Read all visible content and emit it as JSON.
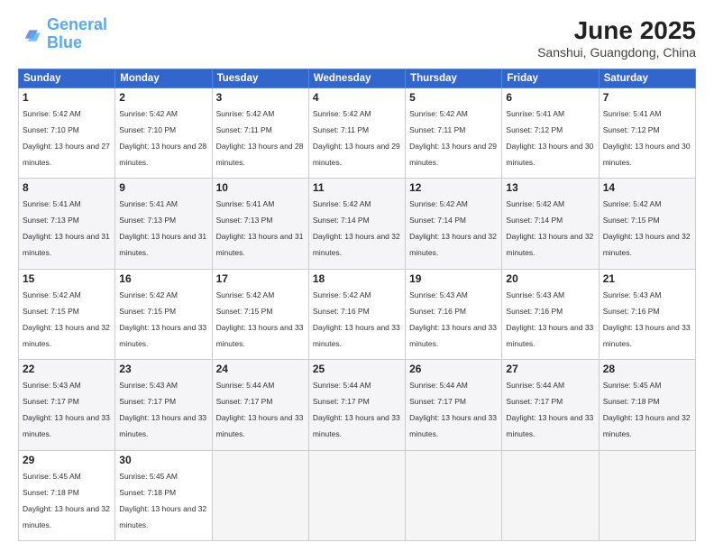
{
  "logo": {
    "line1": "General",
    "line2": "Blue"
  },
  "title": "June 2025",
  "location": "Sanshui, Guangdong, China",
  "weekdays": [
    "Sunday",
    "Monday",
    "Tuesday",
    "Wednesday",
    "Thursday",
    "Friday",
    "Saturday"
  ],
  "days": [
    {
      "num": "1",
      "sunrise": "5:42 AM",
      "sunset": "7:10 PM",
      "daylight": "13 hours and 27 minutes."
    },
    {
      "num": "2",
      "sunrise": "5:42 AM",
      "sunset": "7:10 PM",
      "daylight": "13 hours and 28 minutes."
    },
    {
      "num": "3",
      "sunrise": "5:42 AM",
      "sunset": "7:11 PM",
      "daylight": "13 hours and 28 minutes."
    },
    {
      "num": "4",
      "sunrise": "5:42 AM",
      "sunset": "7:11 PM",
      "daylight": "13 hours and 29 minutes."
    },
    {
      "num": "5",
      "sunrise": "5:42 AM",
      "sunset": "7:11 PM",
      "daylight": "13 hours and 29 minutes."
    },
    {
      "num": "6",
      "sunrise": "5:41 AM",
      "sunset": "7:12 PM",
      "daylight": "13 hours and 30 minutes."
    },
    {
      "num": "7",
      "sunrise": "5:41 AM",
      "sunset": "7:12 PM",
      "daylight": "13 hours and 30 minutes."
    },
    {
      "num": "8",
      "sunrise": "5:41 AM",
      "sunset": "7:13 PM",
      "daylight": "13 hours and 31 minutes."
    },
    {
      "num": "9",
      "sunrise": "5:41 AM",
      "sunset": "7:13 PM",
      "daylight": "13 hours and 31 minutes."
    },
    {
      "num": "10",
      "sunrise": "5:41 AM",
      "sunset": "7:13 PM",
      "daylight": "13 hours and 31 minutes."
    },
    {
      "num": "11",
      "sunrise": "5:42 AM",
      "sunset": "7:14 PM",
      "daylight": "13 hours and 32 minutes."
    },
    {
      "num": "12",
      "sunrise": "5:42 AM",
      "sunset": "7:14 PM",
      "daylight": "13 hours and 32 minutes."
    },
    {
      "num": "13",
      "sunrise": "5:42 AM",
      "sunset": "7:14 PM",
      "daylight": "13 hours and 32 minutes."
    },
    {
      "num": "14",
      "sunrise": "5:42 AM",
      "sunset": "7:15 PM",
      "daylight": "13 hours and 32 minutes."
    },
    {
      "num": "15",
      "sunrise": "5:42 AM",
      "sunset": "7:15 PM",
      "daylight": "13 hours and 32 minutes."
    },
    {
      "num": "16",
      "sunrise": "5:42 AM",
      "sunset": "7:15 PM",
      "daylight": "13 hours and 33 minutes."
    },
    {
      "num": "17",
      "sunrise": "5:42 AM",
      "sunset": "7:15 PM",
      "daylight": "13 hours and 33 minutes."
    },
    {
      "num": "18",
      "sunrise": "5:42 AM",
      "sunset": "7:16 PM",
      "daylight": "13 hours and 33 minutes."
    },
    {
      "num": "19",
      "sunrise": "5:43 AM",
      "sunset": "7:16 PM",
      "daylight": "13 hours and 33 minutes."
    },
    {
      "num": "20",
      "sunrise": "5:43 AM",
      "sunset": "7:16 PM",
      "daylight": "13 hours and 33 minutes."
    },
    {
      "num": "21",
      "sunrise": "5:43 AM",
      "sunset": "7:16 PM",
      "daylight": "13 hours and 33 minutes."
    },
    {
      "num": "22",
      "sunrise": "5:43 AM",
      "sunset": "7:17 PM",
      "daylight": "13 hours and 33 minutes."
    },
    {
      "num": "23",
      "sunrise": "5:43 AM",
      "sunset": "7:17 PM",
      "daylight": "13 hours and 33 minutes."
    },
    {
      "num": "24",
      "sunrise": "5:44 AM",
      "sunset": "7:17 PM",
      "daylight": "13 hours and 33 minutes."
    },
    {
      "num": "25",
      "sunrise": "5:44 AM",
      "sunset": "7:17 PM",
      "daylight": "13 hours and 33 minutes."
    },
    {
      "num": "26",
      "sunrise": "5:44 AM",
      "sunset": "7:17 PM",
      "daylight": "13 hours and 33 minutes."
    },
    {
      "num": "27",
      "sunrise": "5:44 AM",
      "sunset": "7:17 PM",
      "daylight": "13 hours and 33 minutes."
    },
    {
      "num": "28",
      "sunrise": "5:45 AM",
      "sunset": "7:18 PM",
      "daylight": "13 hours and 32 minutes."
    },
    {
      "num": "29",
      "sunrise": "5:45 AM",
      "sunset": "7:18 PM",
      "daylight": "13 hours and 32 minutes."
    },
    {
      "num": "30",
      "sunrise": "5:45 AM",
      "sunset": "7:18 PM",
      "daylight": "13 hours and 32 minutes."
    }
  ]
}
